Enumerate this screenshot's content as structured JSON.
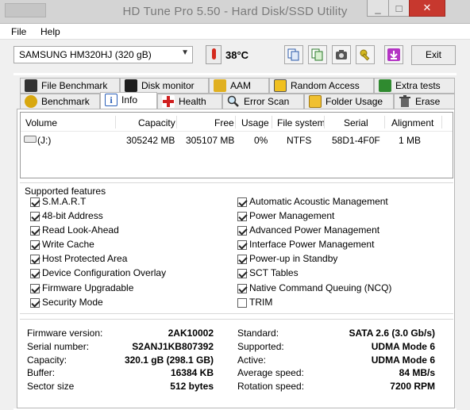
{
  "window": {
    "title": "HD Tune Pro 5.50 - Hard Disk/SSD Utility",
    "minimize": "_",
    "maximize": "□",
    "close": "✕"
  },
  "menu": {
    "file": "File",
    "help": "Help"
  },
  "toolbar": {
    "drive": "SAMSUNG HM320HJ (320 gB)",
    "temperature": "38°C",
    "exit": "Exit"
  },
  "tabs_top": [
    {
      "label": "File Benchmark",
      "icon": "benchmark-file-icon"
    },
    {
      "label": "Disk monitor",
      "icon": "disk-monitor-icon"
    },
    {
      "label": "AAM",
      "icon": "speaker-icon"
    },
    {
      "label": "Random Access",
      "icon": "random-access-icon"
    },
    {
      "label": "Extra tests",
      "icon": "extra-tests-icon"
    }
  ],
  "tabs_bottom": [
    {
      "label": "Benchmark",
      "icon": "benchmark-icon"
    },
    {
      "label": "Info",
      "icon": "info-icon",
      "active": true
    },
    {
      "label": "Health",
      "icon": "health-icon"
    },
    {
      "label": "Error Scan",
      "icon": "magnifier-icon"
    },
    {
      "label": "Folder Usage",
      "icon": "folder-icon"
    },
    {
      "label": "Erase",
      "icon": "trash-icon"
    }
  ],
  "volume_table": {
    "headers": [
      "Volume",
      "Capacity",
      "Free",
      "Usage",
      "File system",
      "Serial",
      "Alignment"
    ],
    "rows": [
      {
        "volume": "(J:)",
        "capacity": "305242 MB",
        "free": "305107 MB",
        "usage": "0%",
        "fs": "NTFS",
        "serial": "58D1-4F0F",
        "alignment": "1 MB"
      }
    ]
  },
  "features": {
    "title": "Supported features",
    "left": [
      {
        "label": "S.M.A.R.T",
        "checked": true
      },
      {
        "label": "48-bit Address",
        "checked": true
      },
      {
        "label": "Read Look-Ahead",
        "checked": true
      },
      {
        "label": "Write Cache",
        "checked": true
      },
      {
        "label": "Host Protected Area",
        "checked": true
      },
      {
        "label": "Device Configuration Overlay",
        "checked": true
      },
      {
        "label": "Firmware Upgradable",
        "checked": true
      },
      {
        "label": "Security Mode",
        "checked": true
      }
    ],
    "right": [
      {
        "label": "Automatic Acoustic Management",
        "checked": true
      },
      {
        "label": "Power Management",
        "checked": true
      },
      {
        "label": "Advanced Power Management",
        "checked": true
      },
      {
        "label": "Interface Power Management",
        "checked": true
      },
      {
        "label": "Power-up in Standby",
        "checked": true
      },
      {
        "label": "SCT Tables",
        "checked": true
      },
      {
        "label": "Native Command Queuing (NCQ)",
        "checked": true
      },
      {
        "label": "TRIM",
        "checked": false
      }
    ]
  },
  "info_left": [
    {
      "label": "Firmware version:",
      "value": "2AK10002"
    },
    {
      "label": "Serial number:",
      "value": "S2ANJ1KB807392"
    },
    {
      "label": "Capacity:",
      "value": "320.1 gB (298.1 GB)"
    },
    {
      "label": "Buffer:",
      "value": "16384 KB"
    },
    {
      "label": "Sector size",
      "value": "512 bytes"
    }
  ],
  "info_right": [
    {
      "label": "Standard:",
      "value": "SATA 2.6 (3.0 Gb/s)"
    },
    {
      "label": "Supported:",
      "value": "UDMA Mode 6"
    },
    {
      "label": "Active:",
      "value": "UDMA Mode 6"
    },
    {
      "label": "Average speed:",
      "value": "84 MB/s"
    },
    {
      "label": "Rotation speed:",
      "value": "7200 RPM"
    }
  ]
}
